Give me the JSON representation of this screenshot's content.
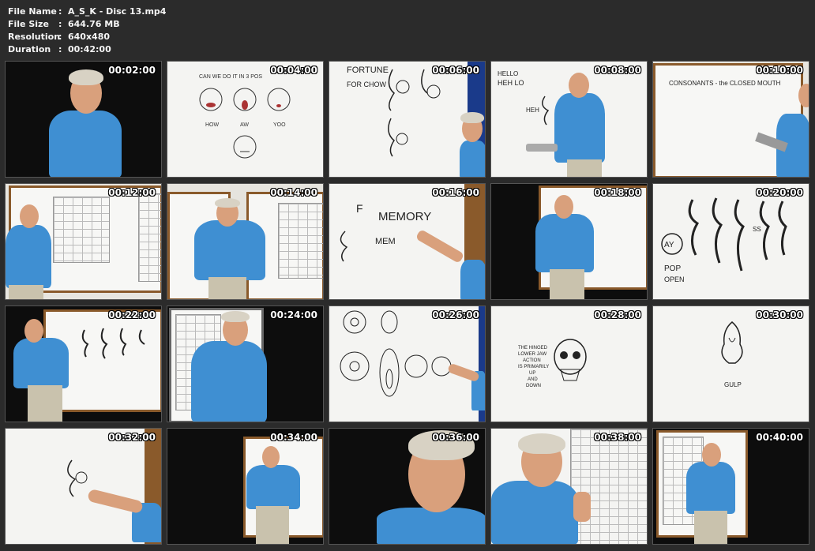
{
  "info": [
    {
      "label": "File Name",
      "sep": ":",
      "value": "A_S_K - Disc 13.mp4"
    },
    {
      "label": "File Size",
      "sep": ":",
      "value": "644.76 MB"
    },
    {
      "label": "Resolution",
      "sep": ":",
      "value": "640x480"
    },
    {
      "label": "Duration",
      "sep": ":",
      "value": "00:42:00"
    }
  ],
  "thumbnails": [
    {
      "time": "00:02:00"
    },
    {
      "time": "00:04:00",
      "text": [
        "CAN WE DO IT IN 3 POS",
        "HOW",
        "AW",
        "YOO"
      ]
    },
    {
      "time": "00:06:00",
      "text": [
        "FORTUNE",
        "FOR CHOW"
      ]
    },
    {
      "time": "00:08:00",
      "text": [
        "HELLO",
        "HEH LO",
        "HEH"
      ]
    },
    {
      "time": "00:10:00",
      "text": [
        "CONSONANTS - the CLOSED MOUTH"
      ]
    },
    {
      "time": "00:12:00"
    },
    {
      "time": "00:14:00"
    },
    {
      "time": "00:16:00",
      "text": [
        "F",
        "MEMORY",
        "MEM"
      ]
    },
    {
      "time": "00:18:00"
    },
    {
      "time": "00:20:00",
      "text": [
        "AY",
        "POP",
        "OPEN",
        "SS"
      ]
    },
    {
      "time": "00:22:00"
    },
    {
      "time": "00:24:00"
    },
    {
      "time": "00:26:00"
    },
    {
      "time": "00:28:00",
      "text": [
        "THE HINGED",
        "LOWER JAW",
        "ACTION",
        "IS PRIMARILY",
        "UP",
        "AND",
        "DOWN"
      ]
    },
    {
      "time": "00:30:00",
      "text": [
        "GULP"
      ]
    },
    {
      "time": "00:32:00"
    },
    {
      "time": "00:34:00"
    },
    {
      "time": "00:36:00"
    },
    {
      "time": "00:38:00"
    },
    {
      "time": "00:40:00"
    }
  ]
}
